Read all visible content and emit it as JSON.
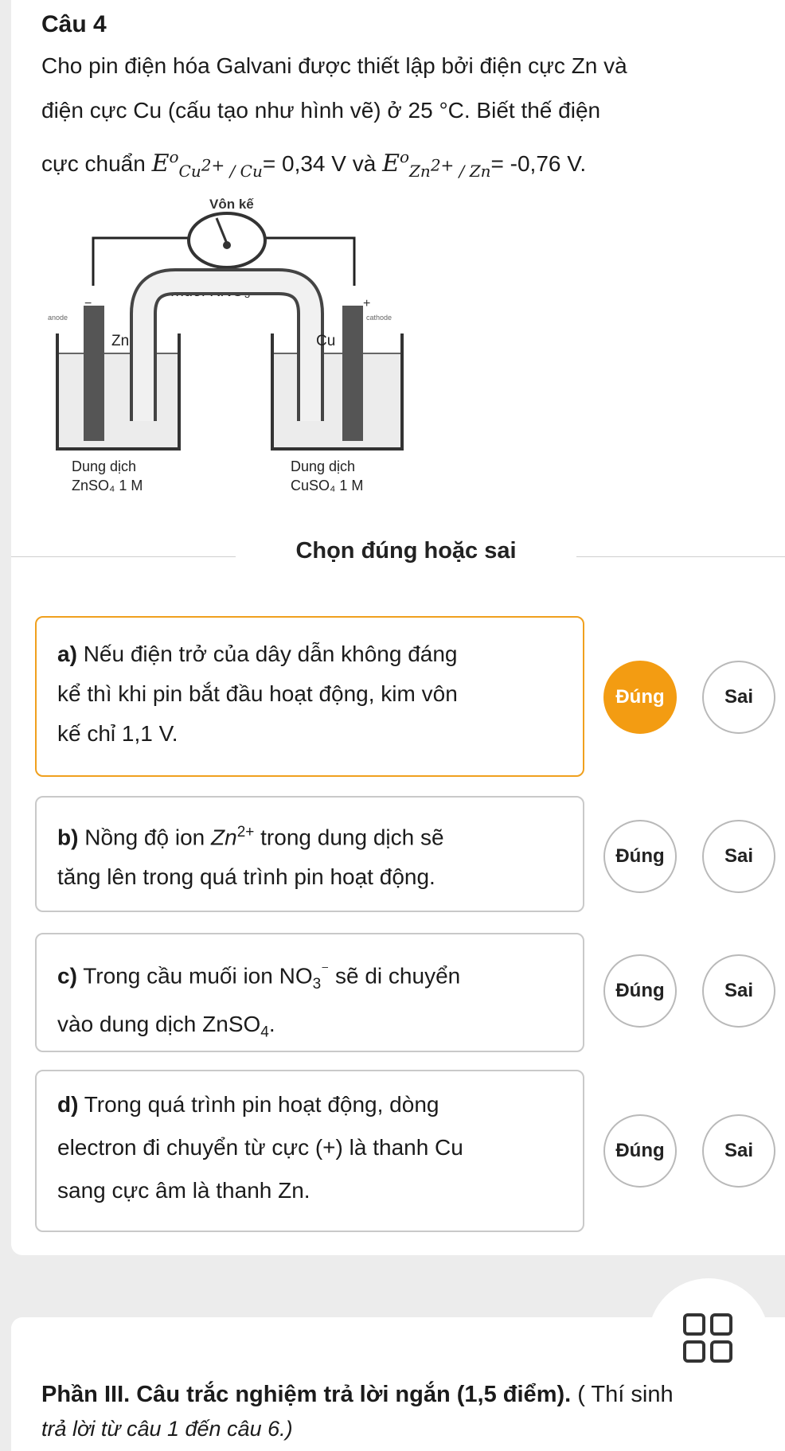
{
  "question": {
    "title": "Câu 4",
    "line1": "Cho pin điện hóa Galvani được thiết lập bởi điện cực Zn và",
    "line2": "điện cực Cu (cấu tạo như hình vẽ) ở 25 °C. Biết thế điện",
    "line3_prefix": "cực chuẩn",
    "e_cu_sub": "Cu",
    "e_cu_sup": "2+",
    "e_cu_sub2": " / Cu",
    "e_cu_value": "= 0,34 V và",
    "e_zn_sub": "Zn",
    "e_zn_sup": "2+",
    "e_zn_sub2": " / Zn",
    "e_zn_value": "= -0,76 V."
  },
  "figure": {
    "voltmeter": "Vôn kế",
    "salt_bridge": "Cầu muối KNO₃",
    "anode": "anode",
    "cathode": "cathode",
    "minus": "−",
    "plus": "+",
    "zn": "Zn",
    "cu": "Cu",
    "left_sol_1": "Dung dịch",
    "left_sol_2": "ZnSO₄ 1 M",
    "right_sol_1": "Dung dịch",
    "right_sol_2": "CuSO₄ 1 M"
  },
  "section_heading": "Chọn đúng hoặc sai",
  "options": [
    {
      "label": "a)",
      "lines": [
        "Nếu điện trở của dây dẫn không đáng",
        "kể thì khi pin bắt đầu hoạt động, kim vôn",
        "kế chỉ 1,1 V."
      ],
      "selected": "Đúng"
    },
    {
      "label": "b)",
      "l1a": "Nồng độ ion ",
      "l1b": "Zn",
      "l1c": "2+",
      "l1d": " trong dung dịch sẽ",
      "l2": "tăng lên trong quá trình pin hoạt động."
    },
    {
      "label": "c)",
      "l1a": "Trong cầu muối ion ",
      "l1b": "NO",
      "l1c": "3",
      "l1d": "⁻",
      "l1e": " sẽ di chuyển",
      "l2": "vào dung dịch ZnSO",
      "l2sub": "4",
      "l2end": "."
    },
    {
      "label": "d)",
      "lines": [
        "Trong quá trình pin hoạt động, dòng",
        "electron đi chuyển từ cực (+) là thanh Cu",
        "sang cực âm là thanh Zn."
      ]
    }
  ],
  "buttons": {
    "true_label": "Đúng",
    "false_label": "Sai"
  },
  "part3": {
    "title": "Phần III. Câu trắc nghiệm trả lời ngắn (1,5 điểm).",
    "title_tail": " ( Thí sinh",
    "subtitle": "trả lời từ câu 1 đến câu 6.)"
  },
  "colors": {
    "accent": "#f39c12",
    "selected_border": "#f0a01e"
  },
  "icons": {
    "menu": "grid-icon"
  }
}
